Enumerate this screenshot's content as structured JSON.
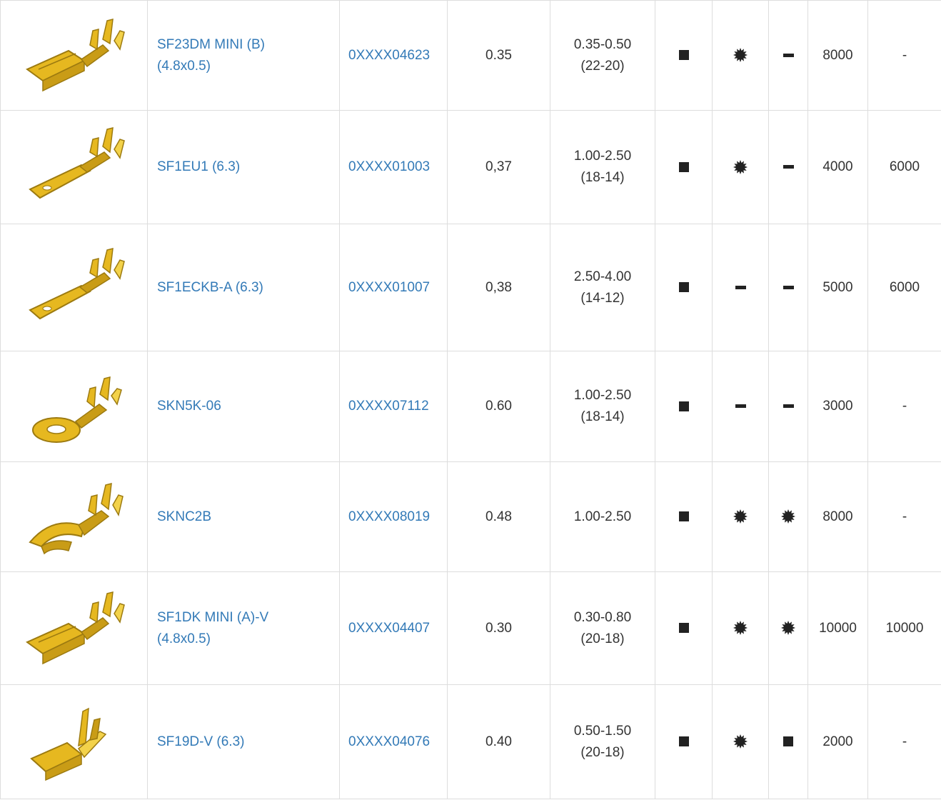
{
  "colors": {
    "link": "#337ab7",
    "text": "#333333",
    "border": "#dddddd",
    "icon": "#222222",
    "terminal_gold": "#e6b820"
  },
  "icon_legend": {
    "square": "filled-square-icon",
    "star": "starburst-icon",
    "dash": "dash-icon"
  },
  "rows": [
    {
      "image_icon": "flag-female-terminal-image",
      "name_lines": [
        "SF23DM MINI (B)",
        "(4.8x0.5)"
      ],
      "code": "0XXXX04623",
      "weight": "0.35",
      "section_lines": [
        "0.35-0.50",
        "(22-20)"
      ],
      "icons": [
        "square",
        "star",
        "dash"
      ],
      "qty1": "8000",
      "qty2": "-"
    },
    {
      "image_icon": "male-tab-terminal-image",
      "name_lines": [
        "SF1EU1 (6.3)"
      ],
      "code": "0XXXX01003",
      "weight": "0,37",
      "section_lines": [
        "1.00-2.50",
        "(18-14)"
      ],
      "icons": [
        "square",
        "star",
        "dash"
      ],
      "qty1": "4000",
      "qty2": "6000"
    },
    {
      "image_icon": "male-tab-terminal-image",
      "name_lines": [
        "SF1ECKB-A (6.3)"
      ],
      "code": "0XXXX01007",
      "weight": "0,38",
      "section_lines": [
        "2.50-4.00",
        "(14-12)"
      ],
      "icons": [
        "square",
        "dash",
        "dash"
      ],
      "qty1": "5000",
      "qty2": "6000"
    },
    {
      "image_icon": "ring-terminal-image",
      "name_lines": [
        "SKN5K-06"
      ],
      "code": "0XXXX07112",
      "weight": "0.60",
      "section_lines": [
        "1.00-2.50",
        "(18-14)"
      ],
      "icons": [
        "square",
        "dash",
        "dash"
      ],
      "qty1": "3000",
      "qty2": "-"
    },
    {
      "image_icon": "fork-terminal-image",
      "name_lines": [
        "SKNC2B"
      ],
      "code": "0XXXX08019",
      "weight": "0.48",
      "section_lines": [
        "1.00-2.50"
      ],
      "icons": [
        "square",
        "star",
        "star"
      ],
      "qty1": "8000",
      "qty2": "-"
    },
    {
      "image_icon": "female-receptacle-terminal-image",
      "name_lines": [
        "SF1DK MINI (A)-V",
        "(4.8x0.5)"
      ],
      "code": "0XXXX04407",
      "weight": "0.30",
      "section_lines": [
        "0.30-0.80",
        "(20-18)"
      ],
      "icons": [
        "square",
        "star",
        "star"
      ],
      "qty1": "10000",
      "qty2": "10000"
    },
    {
      "image_icon": "angled-flag-terminal-image",
      "name_lines": [
        "SF19D-V (6.3)"
      ],
      "code": "0XXXX04076",
      "weight": "0.40",
      "section_lines": [
        "0.50-1.50",
        "(20-18)"
      ],
      "icons": [
        "square",
        "star",
        "square"
      ],
      "qty1": "2000",
      "qty2": "-"
    }
  ]
}
